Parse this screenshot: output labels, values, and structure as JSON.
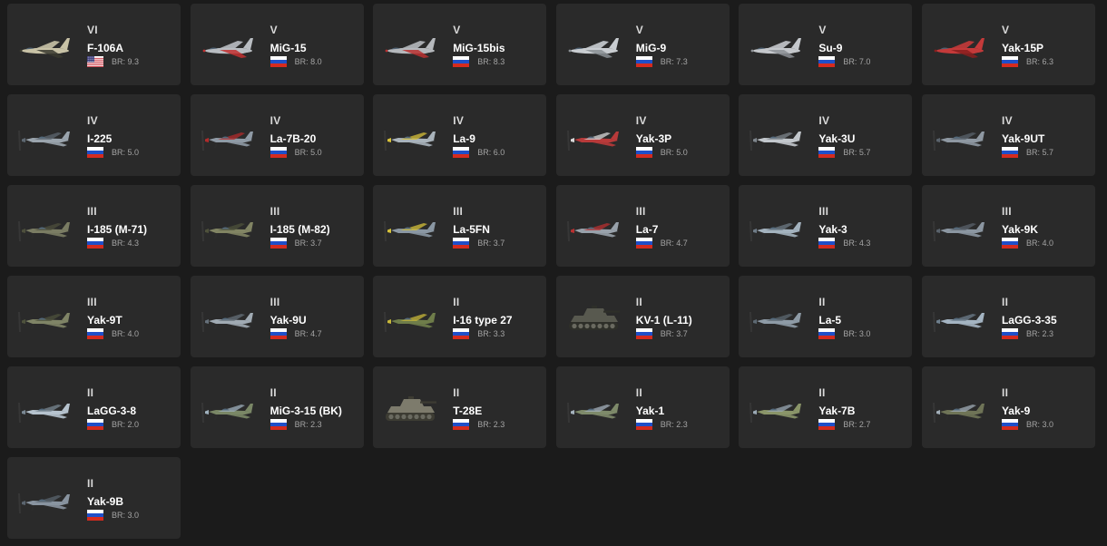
{
  "colors": {
    "background": "#1b1b1b",
    "card": "#2a2a2a",
    "rank_text": "#d9d9d9",
    "name_text": "#ffffff",
    "br_text": "#a4a4a4"
  },
  "vehicles": [
    {
      "rank": "VI",
      "name": "F-106A",
      "br": "BR: 9.3",
      "country": "usa",
      "kind": "jet",
      "hull": "#c8c2a6",
      "accent": "#3a3a2f"
    },
    {
      "rank": "V",
      "name": "MiG-15",
      "br": "BR: 8.0",
      "country": "ussr",
      "kind": "jet",
      "hull": "#b9bdc2",
      "accent": "#c23030"
    },
    {
      "rank": "V",
      "name": "MiG-15bis",
      "br": "BR: 8.3",
      "country": "ussr",
      "kind": "jet",
      "hull": "#b5b8bc",
      "accent": "#b93030"
    },
    {
      "rank": "V",
      "name": "MiG-9",
      "br": "BR: 7.3",
      "country": "ussr",
      "kind": "jet",
      "hull": "#c9cdd1",
      "accent": "#8a8f94"
    },
    {
      "rank": "V",
      "name": "Su-9",
      "br": "BR: 7.0",
      "country": "ussr",
      "kind": "jet",
      "hull": "#c4c7cb",
      "accent": "#8d9196"
    },
    {
      "rank": "V",
      "name": "Yak-15P",
      "br": "BR: 6.3",
      "country": "ussr",
      "kind": "jet",
      "hull": "#c43a3a",
      "accent": "#8a1f1f"
    },
    {
      "rank": "IV",
      "name": "I-225",
      "br": "BR: 5.0",
      "country": "ussr",
      "kind": "prop",
      "hull": "#9aa4ad",
      "accent": "#5d6770"
    },
    {
      "rank": "IV",
      "name": "La-7B-20",
      "br": "BR: 5.0",
      "country": "ussr",
      "kind": "prop",
      "hull": "#8f9aa5",
      "accent": "#b02b2b"
    },
    {
      "rank": "IV",
      "name": "La-9",
      "br": "BR: 6.0",
      "country": "ussr",
      "kind": "prop",
      "hull": "#a9b3bb",
      "accent": "#d8c23a"
    },
    {
      "rank": "IV",
      "name": "Yak-3P",
      "br": "BR: 5.0",
      "country": "ussr",
      "kind": "prop",
      "hull": "#b83a3a",
      "accent": "#d9d9d9"
    },
    {
      "rank": "IV",
      "name": "Yak-3U",
      "br": "BR: 5.7",
      "country": "ussr",
      "kind": "prop",
      "hull": "#c2c7cc",
      "accent": "#7e858c"
    },
    {
      "rank": "IV",
      "name": "Yak-9UT",
      "br": "BR: 5.7",
      "country": "ussr",
      "kind": "prop",
      "hull": "#8e98a2",
      "accent": "#5a636c"
    },
    {
      "rank": "III",
      "name": "I-185 (M-71)",
      "br": "BR: 4.3",
      "country": "ussr",
      "kind": "prop",
      "hull": "#7a7c63",
      "accent": "#4d4f3c"
    },
    {
      "rank": "III",
      "name": "I-185 (M-82)",
      "br": "BR: 3.7",
      "country": "ussr",
      "kind": "prop",
      "hull": "#818463",
      "accent": "#4e513b"
    },
    {
      "rank": "III",
      "name": "La-5FN",
      "br": "BR: 3.7",
      "country": "ussr",
      "kind": "prop",
      "hull": "#8a97a3",
      "accent": "#d6c23a"
    },
    {
      "rank": "III",
      "name": "La-7",
      "br": "BR: 4.7",
      "country": "ussr",
      "kind": "prop",
      "hull": "#98a1aa",
      "accent": "#b83030"
    },
    {
      "rank": "III",
      "name": "Yak-3",
      "br": "BR: 4.3",
      "country": "ussr",
      "kind": "prop",
      "hull": "#a3b2be",
      "accent": "#6e7b86"
    },
    {
      "rank": "III",
      "name": "Yak-9K",
      "br": "BR: 4.0",
      "country": "ussr",
      "kind": "prop",
      "hull": "#8b96a1",
      "accent": "#59626b"
    },
    {
      "rank": "III",
      "name": "Yak-9T",
      "br": "BR: 4.0",
      "country": "ussr",
      "kind": "prop",
      "hull": "#7f8466",
      "accent": "#4e523c"
    },
    {
      "rank": "III",
      "name": "Yak-9U",
      "br": "BR: 4.7",
      "country": "ussr",
      "kind": "prop",
      "hull": "#a0aab3",
      "accent": "#66707a"
    },
    {
      "rank": "II",
      "name": "I-16 type 27",
      "br": "BR: 3.3",
      "country": "ussr",
      "kind": "prop",
      "hull": "#6f7d4a",
      "accent": "#c8b83a"
    },
    {
      "rank": "II",
      "name": "KV-1 (L-11)",
      "br": "BR: 3.7",
      "country": "ussr",
      "kind": "tank",
      "hull": "#58594f",
      "accent": "#2e2f29"
    },
    {
      "rank": "II",
      "name": "La-5",
      "br": "BR: 3.0",
      "country": "ussr",
      "kind": "prop",
      "hull": "#8e9ba6",
      "accent": "#5c6872"
    },
    {
      "rank": "II",
      "name": "LaGG-3-35",
      "br": "BR: 2.3",
      "country": "ussr",
      "kind": "prop",
      "hull": "#a4b4c2",
      "accent": "#6d7e8c"
    },
    {
      "rank": "II",
      "name": "LaGG-3-8",
      "br": "BR: 2.0",
      "country": "ussr",
      "kind": "prop",
      "hull": "#b6c3ce",
      "accent": "#7a8893"
    },
    {
      "rank": "II",
      "name": "MiG-3-15 (BK)",
      "br": "BR: 2.3",
      "country": "ussr",
      "kind": "prop",
      "hull": "#7a8766",
      "accent": "#9fb0bd"
    },
    {
      "rank": "II",
      "name": "T-28E",
      "br": "BR: 2.3",
      "country": "ussr",
      "kind": "tank",
      "hull": "#7d7b6c",
      "accent": "#3d3c33"
    },
    {
      "rank": "II",
      "name": "Yak-1",
      "br": "BR: 2.3",
      "country": "ussr",
      "kind": "prop",
      "hull": "#7e8a6a",
      "accent": "#a5b2bd"
    },
    {
      "rank": "II",
      "name": "Yak-7B",
      "br": "BR: 2.7",
      "country": "ussr",
      "kind": "prop",
      "hull": "#8a9569",
      "accent": "#9aa8b4"
    },
    {
      "rank": "II",
      "name": "Yak-9",
      "br": "BR: 3.0",
      "country": "ussr",
      "kind": "prop",
      "hull": "#6f7457",
      "accent": "#a2aeb8"
    },
    {
      "rank": "II",
      "name": "Yak-9B",
      "br": "BR: 3.0",
      "country": "ussr",
      "kind": "prop",
      "hull": "#8994a0",
      "accent": "#5a646e"
    }
  ]
}
